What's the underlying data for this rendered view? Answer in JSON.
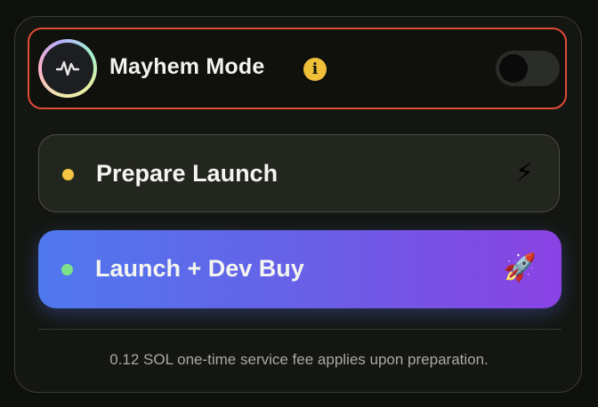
{
  "mayhem": {
    "title": "Mayhem Mode",
    "info_icon": "info-icon",
    "toggle_on": false,
    "icon": "waveform-icon"
  },
  "actions": {
    "prepare": {
      "label": "Prepare Launch",
      "emoji": "⚡",
      "dot_color": "#f5c542"
    },
    "launch": {
      "label": "Launch + Dev Buy",
      "emoji": "🚀",
      "dot_color": "#7be08a"
    }
  },
  "footer": {
    "fee_note": "0.12 SOL one-time service fee applies upon preparation."
  },
  "colors": {
    "accent_red": "#e04a3a",
    "info_yellow": "#f0bf3a",
    "gradient_start": "#4f78ee",
    "gradient_end": "#8a42e4"
  }
}
